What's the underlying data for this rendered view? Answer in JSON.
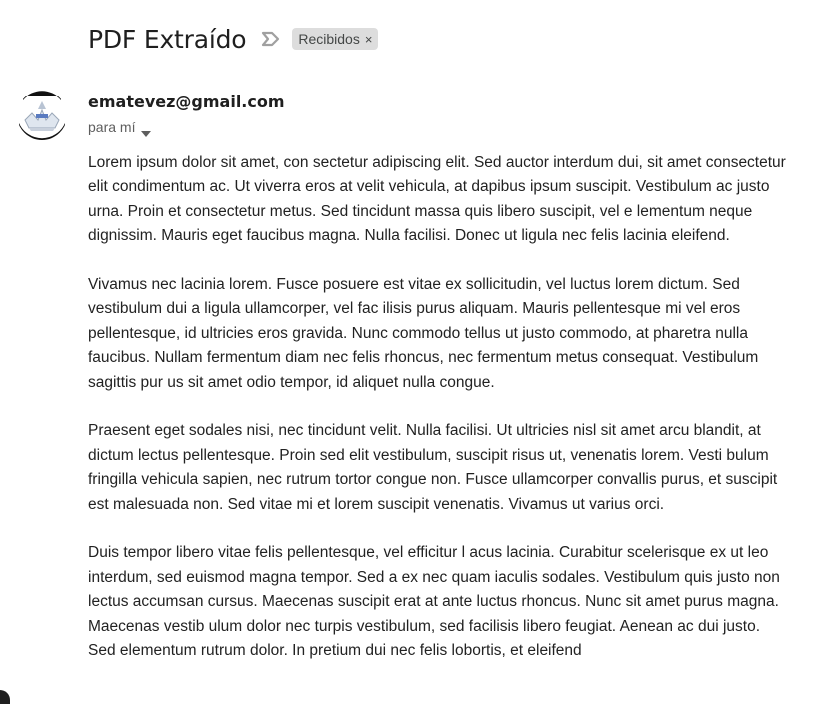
{
  "email": {
    "subject": "PDF Extraído",
    "label": {
      "name": "Recibidos",
      "remove_glyph": "×"
    },
    "sender": {
      "address": "ematevez@gmail.com",
      "to_text": "para mí"
    },
    "body_paragraphs": [
      "Lorem ipsum dolor sit amet, con sectetur adipiscing elit. Sed auctor interdum dui, sit amet consectetur elit condimentum ac. Ut viverra eros at velit vehicula, at dapibus ipsum suscipit. Vestibulum ac justo urna. Proin et consectetur metus. Sed tincidunt massa quis libero suscipit, vel e lementum neque dignissim. Mauris eget faucibus magna. Nulla facilisi. Donec ut ligula nec felis lacinia eleifend.",
      "Vivamus nec lacinia lorem. Fusce posuere est vitae ex sollicitudin, vel luctus lorem dictum. Sed vestibulum dui a ligula ullamcorper, vel fac ilisis purus aliquam. Mauris pellentesque mi vel eros pellentesque, id ultricies eros gravida. Nunc commodo tellus ut justo commodo, at pharetra nulla faucibus. Nullam fermentum diam nec felis rhoncus, nec fermentum metus consequat. Vestibulum sagittis pur us sit amet odio tempor, id aliquet nulla congue.",
      "Praesent eget sodales nisi, nec tincidunt velit. Nulla facilisi. Ut ultricies nisl sit amet arcu blandit, at dictum lectus pellentesque. Proin sed elit vestibulum, suscipit risus ut, venenatis lorem. Vesti bulum fringilla vehicula sapien, nec rutrum tortor congue non. Fusce ullamcorper convallis purus, et suscipit est malesuada non. Sed vitae mi et lorem suscipit venenatis. Vivamus ut varius orci.",
      "Duis tempor libero vitae felis pellentesque, vel efficitur l acus lacinia. Curabitur scelerisque ex ut leo interdum, sed euismod magna tempor. Sed a ex nec quam iaculis sodales. Vestibulum quis justo non lectus accumsan cursus. Maecenas suscipit erat at ante luctus rhoncus. Nunc sit amet purus magna. Maecenas vestib ulum dolor nec turpis vestibulum, sed facilisis libero feugiat. Aenean ac dui justo. Sed elementum rutrum dolor. In pretium dui nec felis lobortis, et eleifend"
    ]
  },
  "icons": {
    "importance": "importance-marker-icon",
    "caret": "caret-down-icon",
    "avatar": "sender-avatar-image"
  },
  "colors": {
    "chip_bg": "#dddddd",
    "text_primary": "#1f1f1f",
    "text_secondary": "#5e5e5e",
    "importance_gray": "#a0a0a0"
  }
}
